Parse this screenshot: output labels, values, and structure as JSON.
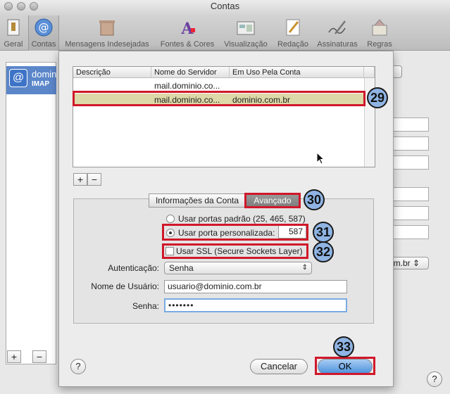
{
  "window": {
    "title": "Contas"
  },
  "toolbar": {
    "items": [
      {
        "label": "Geral"
      },
      {
        "label": "Contas"
      },
      {
        "label": "Mensagens Indesejadas"
      },
      {
        "label": "Fontes & Cores"
      },
      {
        "label": "Visualização"
      },
      {
        "label": "Redação"
      },
      {
        "label": "Assinaturas"
      },
      {
        "label": "Regras"
      }
    ]
  },
  "background": {
    "account_name": "domin",
    "account_type": "IMAP",
    "popup_fragment": "om.br",
    "popup_arrows": "⇕",
    "add_label": "+",
    "remove_label": "−",
    "help_label": "?"
  },
  "server_table": {
    "columns": [
      "Descrição",
      "Nome do Servidor",
      "Em Uso Pela Conta"
    ],
    "rows": [
      {
        "descricao": "",
        "servidor": "mail.dominio.co...",
        "conta": ""
      },
      {
        "descricao": "",
        "servidor": "mail.dominio.co...",
        "conta": "dominio.com.br"
      }
    ],
    "add_label": "+",
    "remove_label": "−"
  },
  "tabs": [
    {
      "label": "Informações da Conta"
    },
    {
      "label": "Avançado"
    }
  ],
  "advanced": {
    "default_ports_label": "Usar portas padrão (25, 465, 587)",
    "custom_port_label": "Usar porta personalizada:",
    "custom_port_value": "587",
    "ssl_label": "Usar SSL (Secure Sockets Layer)",
    "auth_label": "Autenticação:",
    "auth_value": "Senha",
    "username_label": "Nome de Usuário:",
    "username_value": "usuario@dominio.com.br",
    "password_label": "Senha:",
    "password_value": "•••••••"
  },
  "buttons": {
    "cancel": "Cancelar",
    "ok": "OK",
    "help": "?"
  },
  "steps": [
    "29",
    "30",
    "31",
    "32",
    "33"
  ]
}
